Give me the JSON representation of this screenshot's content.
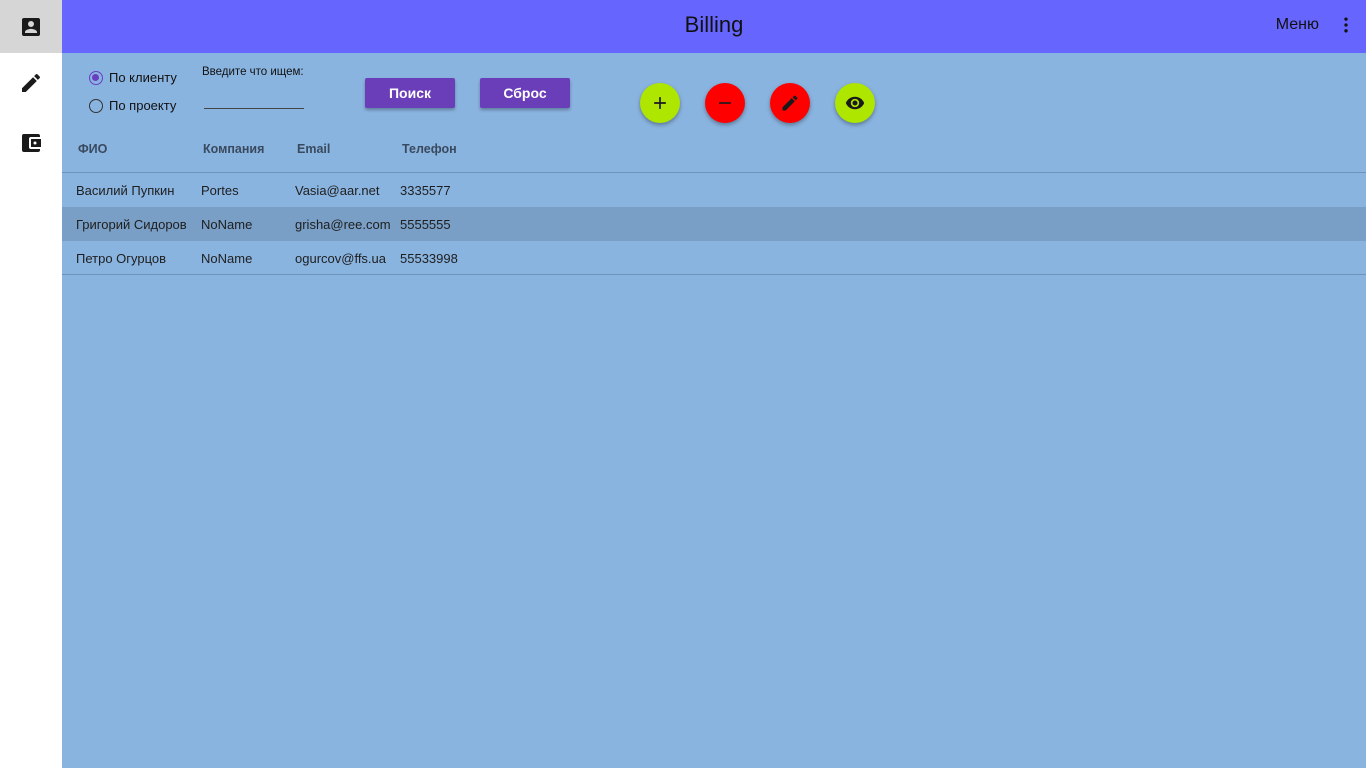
{
  "app": {
    "title": "Billing",
    "menu_label": "Меню",
    "accent": "#6666ff"
  },
  "nav": [
    {
      "icon": "contact-card-icon",
      "active": true
    },
    {
      "icon": "pencil-icon",
      "active": false
    },
    {
      "icon": "wallet-icon",
      "active": false
    }
  ],
  "filters": {
    "radio_client": "По клиенту",
    "radio_project": "По проекту",
    "selected": "client",
    "search_label": "Введите что ищем:",
    "search_value": ""
  },
  "buttons": {
    "search": "Поиск",
    "reset": "Сброс"
  },
  "actions": [
    {
      "icon": "plus-icon",
      "color": "#aee600"
    },
    {
      "icon": "minus-icon",
      "color": "#ff0000"
    },
    {
      "icon": "pencil-icon",
      "color": "#ff0000"
    },
    {
      "icon": "eye-icon",
      "color": "#aee600"
    }
  ],
  "table": {
    "columns": [
      "ФИО",
      "Компания",
      "Email",
      "Телефон"
    ],
    "rows": [
      [
        "Василий Пупкин",
        "Portes",
        "Vasia@aar.net",
        "3335577"
      ],
      [
        "Григорий Сидоров",
        "NoName",
        "grisha@ree.com",
        "5555555"
      ],
      [
        "Петро Огурцов",
        "NoName",
        "ogurcov@ffs.ua",
        "55533998"
      ]
    ],
    "selected_row": 1
  }
}
